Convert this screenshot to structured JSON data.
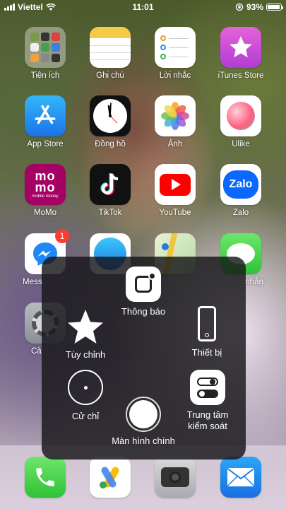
{
  "status_bar": {
    "carrier": "Viettel",
    "time": "11:01",
    "battery": "93%",
    "battery_level": 0.93
  },
  "apps": [
    {
      "label": "Tiện ích",
      "icon": "folder-icon"
    },
    {
      "label": "Ghi chú",
      "icon": "notes-icon"
    },
    {
      "label": "Lời nhắc",
      "icon": "reminders-icon"
    },
    {
      "label": "iTunes Store",
      "icon": "itunes-star-icon"
    },
    {
      "label": "App Store",
      "icon": "app-store-icon"
    },
    {
      "label": "Đồng hồ",
      "icon": "clock-icon"
    },
    {
      "label": "Ảnh",
      "icon": "photos-icon"
    },
    {
      "label": "Ulike",
      "icon": "ulike-icon"
    },
    {
      "label": "MoMo",
      "icon": "momo-icon",
      "icon_text": "mo",
      "icon_subtext": "mobile money"
    },
    {
      "label": "TikTok",
      "icon": "tiktok-icon"
    },
    {
      "label": "YouTube",
      "icon": "youtube-icon"
    },
    {
      "label": "Zalo",
      "icon": "zalo-icon",
      "icon_text": "Zalo"
    },
    {
      "label": "Mess",
      "icon": "messenger-icon",
      "badge": "1"
    },
    {
      "label": "",
      "icon": "safari-icon"
    },
    {
      "label": "",
      "icon": "maps-icon"
    },
    {
      "label": "nhắn",
      "icon": "messages-icon"
    },
    {
      "label": "Cà",
      "icon": "settings-icon"
    }
  ],
  "dock": [
    {
      "icon": "phone-icon"
    },
    {
      "icon": "google-ads-icon"
    },
    {
      "icon": "camera-icon"
    },
    {
      "icon": "mail-icon"
    }
  ],
  "assistive_touch": {
    "notifications": "Thông báo",
    "custom": "Tùy chỉnh",
    "device": "Thiết bị",
    "gestures": "Cử chỉ",
    "control_center_line1": "Trung tâm",
    "control_center_line2": "kiểm soát",
    "home": "Màn hình chính"
  }
}
